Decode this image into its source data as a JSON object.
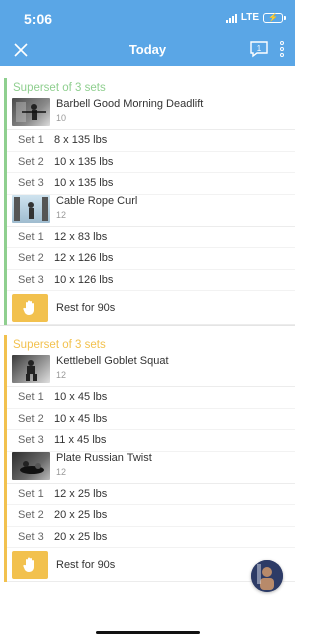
{
  "status": {
    "time": "5:06",
    "network": "LTE"
  },
  "header": {
    "title": "Today"
  },
  "colors": {
    "header_bg": "#5aa6e6",
    "superset1": "#8fcf8f",
    "superset2": "#f2c14e"
  },
  "supersets": [
    {
      "title": "Superset of 3 sets",
      "exercises": [
        {
          "name": "Barbell Good Morning Deadlift",
          "reps": "10",
          "sets": [
            {
              "label": "Set 1",
              "value": "8 x 135 lbs"
            },
            {
              "label": "Set 2",
              "value": "10 x 135 lbs"
            },
            {
              "label": "Set 3",
              "value": "10 x 135 lbs"
            }
          ]
        },
        {
          "name": "Cable Rope Curl",
          "reps": "12",
          "sets": [
            {
              "label": "Set 1",
              "value": "12 x 83 lbs"
            },
            {
              "label": "Set 2",
              "value": "12 x 126 lbs"
            },
            {
              "label": "Set 3",
              "value": "10 x 126 lbs"
            }
          ]
        }
      ],
      "rest": "Rest for 90s"
    },
    {
      "title": "Superset of 3 sets",
      "exercises": [
        {
          "name": "Kettlebell Goblet Squat",
          "reps": "12",
          "sets": [
            {
              "label": "Set 1",
              "value": "10 x 45 lbs"
            },
            {
              "label": "Set 2",
              "value": "10 x 45 lbs"
            },
            {
              "label": "Set 3",
              "value": "11 x 45 lbs"
            }
          ]
        },
        {
          "name": "Plate Russian Twist",
          "reps": "12",
          "sets": [
            {
              "label": "Set 1",
              "value": "12 x 25 lbs"
            },
            {
              "label": "Set 2",
              "value": "20 x 25 lbs"
            },
            {
              "label": "Set 3",
              "value": "20 x 25 lbs"
            }
          ]
        }
      ],
      "rest": "Rest for 90s"
    }
  ]
}
